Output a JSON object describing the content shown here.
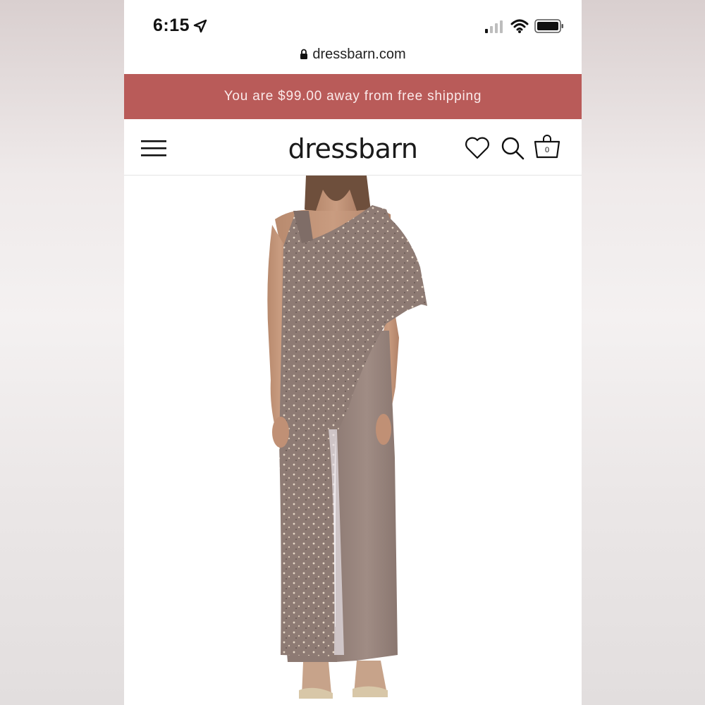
{
  "status_bar": {
    "time": "6:15"
  },
  "browser": {
    "url": "dressbarn.com"
  },
  "promo_banner": {
    "text": "You are $99.00 away from free shipping",
    "color": "#b95b59"
  },
  "header": {
    "logo": "dressbarn"
  },
  "icons": [
    "location-arrow-icon",
    "signal-icon",
    "wifi-icon",
    "battery-icon",
    "lock-icon",
    "menu-icon",
    "heart-icon",
    "search-icon",
    "bag-icon"
  ],
  "product": {
    "image_alt": "Model wearing taupe sequin asymmetric cape overlay jumpsuit"
  }
}
